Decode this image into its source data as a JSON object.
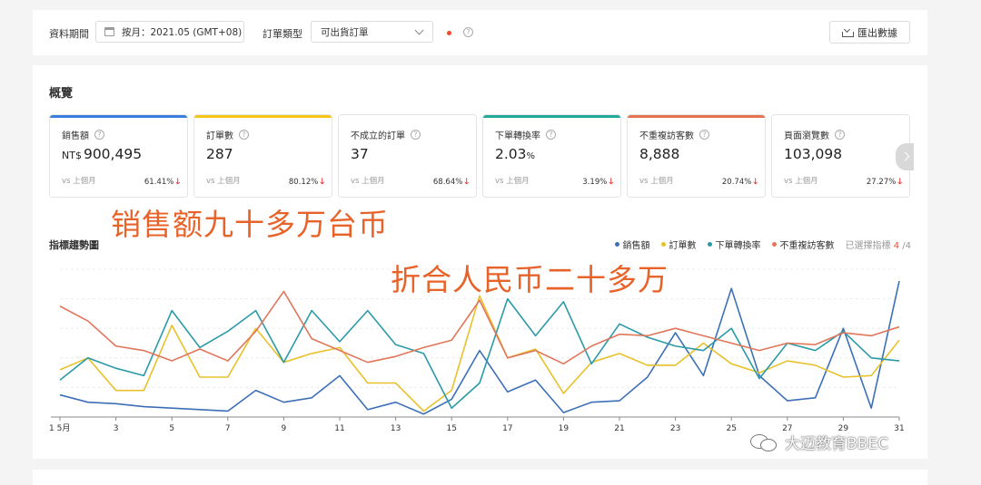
{
  "filters": {
    "period_label": "資料期間",
    "period_value": "按月：2021.05 (GMT+08)",
    "order_type_label": "訂單類型",
    "order_type_value": "可出貨訂單",
    "help_glyph": "?",
    "export_label": "匯出數據"
  },
  "overview": {
    "title": "概覽",
    "cards": [
      {
        "label": "銷售額",
        "prefix": "NT$",
        "value": "900,495",
        "suffix": "",
        "vs": "vs 上個月",
        "change": "61.41%",
        "bar_color": "#3b7ddd"
      },
      {
        "label": "訂單數",
        "prefix": "",
        "value": "287",
        "suffix": "",
        "vs": "vs 上個月",
        "change": "80.12%",
        "bar_color": "#f5c518"
      },
      {
        "label": "不成立的訂單",
        "prefix": "",
        "value": "37",
        "suffix": "",
        "vs": "vs 上個月",
        "change": "68.64%",
        "bar_color": ""
      },
      {
        "label": "下單轉換率",
        "prefix": "",
        "value": "2.03",
        "suffix": "%",
        "vs": "vs 上個月",
        "change": "3.19%",
        "bar_color": "#22a99a"
      },
      {
        "label": "不重複訪客數",
        "prefix": "",
        "value": "8,888",
        "suffix": "",
        "vs": "vs 上個月",
        "change": "20.74%",
        "bar_color": "#e6734f"
      },
      {
        "label": "頁面瀏覽數",
        "prefix": "",
        "value": "103,098",
        "suffix": "",
        "vs": "vs 上個月",
        "change": "27.27%",
        "bar_color": ""
      }
    ],
    "down_arrow": "🡓"
  },
  "trend": {
    "title": "指標趨勢圖",
    "selected_label": "已選擇指標",
    "selected_count": "4",
    "selected_total": " /4"
  },
  "chart_data": {
    "type": "line",
    "x": [
      "1 5月",
      "2",
      "3",
      "4",
      "5",
      "6",
      "7",
      "8",
      "9",
      "10",
      "11",
      "12",
      "13",
      "14",
      "15",
      "16",
      "17",
      "18",
      "19",
      "20",
      "21",
      "22",
      "23",
      "24",
      "25",
      "26",
      "27",
      "28",
      "29",
      "30",
      "31"
    ],
    "tick_labels": [
      "1 5月",
      "3",
      "5",
      "7",
      "9",
      "11",
      "13",
      "15",
      "17",
      "19",
      "21",
      "23",
      "25",
      "27",
      "29",
      "31"
    ],
    "ylim": [
      0,
      100
    ],
    "grid": true,
    "legend_position": "top-right",
    "series": [
      {
        "name": "銷售額",
        "color": "#3d6fb6",
        "values": [
          15,
          10,
          9,
          7,
          6,
          5,
          4,
          18,
          10,
          13,
          28,
          5,
          10,
          2,
          12,
          45,
          17,
          25,
          3,
          10,
          11,
          27,
          57,
          28,
          87,
          28,
          11,
          13,
          60,
          6,
          92
        ]
      },
      {
        "name": "訂單數",
        "color": "#e8c12b",
        "values": [
          32,
          40,
          18,
          18,
          62,
          27,
          27,
          60,
          37,
          43,
          47,
          23,
          23,
          4,
          18,
          82,
          40,
          46,
          16,
          37,
          43,
          35,
          35,
          50,
          36,
          30,
          38,
          35,
          27,
          28,
          52
        ]
      },
      {
        "name": "下單轉換率",
        "color": "#2b9aa8",
        "values": [
          25,
          40,
          33,
          28,
          72,
          47,
          58,
          72,
          37,
          72,
          51,
          72,
          49,
          43,
          6,
          23,
          80,
          55,
          78,
          36,
          63,
          54,
          48,
          45,
          60,
          26,
          50,
          45,
          58,
          40,
          38
        ]
      },
      {
        "name": "不重複訪客數",
        "color": "#e0765a",
        "values": [
          75,
          65,
          48,
          45,
          38,
          46,
          38,
          58,
          85,
          53,
          45,
          37,
          41,
          47,
          52,
          79,
          40,
          45,
          36,
          48,
          56,
          55,
          60,
          55,
          50,
          45,
          50,
          49,
          57,
          55,
          61
        ]
      }
    ]
  },
  "overlays": {
    "line1": "销售额九十多万台币",
    "line2": "折合人民币二十多万"
  },
  "watermark": {
    "text": "大迈教育BBEC",
    "icon": "wechat-icon"
  }
}
